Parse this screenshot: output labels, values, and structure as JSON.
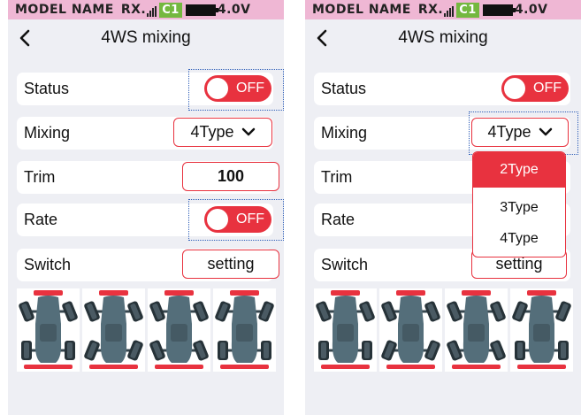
{
  "status_bar": {
    "model_name": "MODEL NAME",
    "rx_label": "RX.",
    "channel": "C1",
    "battery_voltage": "4.0V"
  },
  "header": {
    "title": "4WS mixing",
    "back_icon": "chevron-left-icon"
  },
  "rows": {
    "status_label": "Status",
    "mixing_label": "Mixing",
    "trim_label": "Trim",
    "rate_label": "Rate",
    "switch_label": "Switch"
  },
  "controls": {
    "status_toggle": "OFF",
    "mixing_value": "4Type",
    "trim_value": "100",
    "rate_toggle": "OFF",
    "switch_value": "setting"
  },
  "dropdown": {
    "options": [
      "2Type",
      "3Type",
      "4Type"
    ],
    "highlighted": "2Type"
  },
  "steering_types": [
    "front-steer",
    "rear-steer",
    "crab-steer",
    "counter-steer"
  ],
  "colors": {
    "accent_red": "#e8323f",
    "status_bar_pink": "#efb7d4",
    "channel_green": "#74b83f",
    "selection_outline_blue": "#2f5fb8",
    "screen_bg": "#eeeff4"
  }
}
